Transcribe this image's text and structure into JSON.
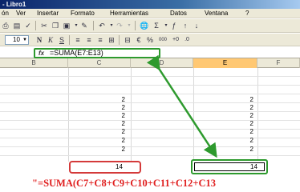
{
  "window": {
    "title": "- Libro1"
  },
  "menu": {
    "items": [
      "ón",
      "Ver",
      "Insertar",
      "Formato",
      "Herramientas",
      "Datos",
      "Ventana",
      "?"
    ]
  },
  "format_toolbar": {
    "font_size": "10",
    "bold": "N",
    "italic": "K",
    "underline": "S",
    "currency": "€",
    "percent": "%",
    "thousands": "000"
  },
  "formula_bar": {
    "fx": "fx",
    "formula": "=SUMA(E7:E13)"
  },
  "columns": [
    "B",
    "C",
    "D",
    "E",
    "F"
  ],
  "selected_column": "E",
  "sheet": {
    "column_c_values": [
      "2",
      "2",
      "2",
      "2",
      "2",
      "2",
      "2"
    ],
    "column_e_values": [
      "2",
      "2",
      "2",
      "2",
      "2",
      "2",
      "2"
    ],
    "sum_c": "14",
    "sum_e": "14"
  },
  "annotation": {
    "long_formula": "\"=SUMA(C7+C8+C9+C10+C11+C12+C13",
    "colors": {
      "green": "#2e9a2e",
      "red": "#d43a3a",
      "formula_red": "#e02020"
    }
  }
}
